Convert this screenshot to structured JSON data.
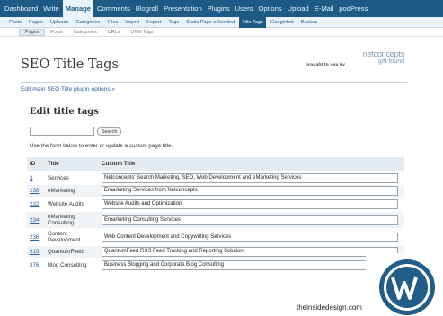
{
  "main_nav": [
    "Dashboard",
    "Write",
    "Manage",
    "Comments",
    "Blogroll",
    "Presentation",
    "Plugins",
    "Users",
    "Options",
    "Upload",
    "E-Mail",
    "podPress"
  ],
  "main_nav_active": "Manage",
  "sub_nav": [
    "Posts",
    "Pages",
    "Uploads",
    "Categories",
    "Files",
    "Import",
    "Export",
    "Tags",
    "Static Page eXtended",
    "Title Tags",
    "Googlebot",
    "Backup"
  ],
  "sub_nav_active": "Title Tags",
  "subsub_nav": [
    "Pages",
    "Posts",
    "Categories",
    "URLs",
    "UTW Tags"
  ],
  "subsub_nav_active": "Pages",
  "page_title": "SEO Title Tags",
  "brought_by": "brought to you by",
  "logo": {
    "line1": "netconcepts",
    "line2": "get found"
  },
  "edit_link": "Edit main SEO Title plugin options »",
  "section_title": "Edit title tags",
  "search": {
    "button_label": "Search",
    "value": ""
  },
  "help_text": "Use the form below to enter or update a custom page title.",
  "table": {
    "headers": {
      "id": "ID",
      "title": "Title",
      "custom": "Custom Title"
    },
    "rows": [
      {
        "id": "3",
        "title": "Services",
        "custom": "Netconcepts' Search Marketing, SEO, Web Development and eMarketing Services"
      },
      {
        "id": "238",
        "title": "eMarketing",
        "custom": "Emarketing Services from Netconcepts"
      },
      {
        "id": "232",
        "title": "Website Audits",
        "custom": "Website Audits and Optimization"
      },
      {
        "id": "234",
        "title": "eMarketing Consulting",
        "custom": "Emarketing Consulting Services"
      },
      {
        "id": "236",
        "title": "Content Development",
        "custom": "Web Content Development and Copywriting Services"
      },
      {
        "id": "919",
        "title": "QuantumFeed",
        "custom": "QuantumFeed RSS Feed Tracking and Reporting Solution"
      },
      {
        "id": "376",
        "title": "Blog Consulting",
        "custom": "Business Blogging and Corporate Blog Consulting"
      }
    ]
  },
  "watermark": "theinsidedesign.com",
  "colors": {
    "nav_bg": "#1d5b86",
    "link": "#2a5fa0",
    "header_bg": "#e4ebf1"
  },
  "icons": {
    "wordpress": "wordpress-logo-icon"
  }
}
